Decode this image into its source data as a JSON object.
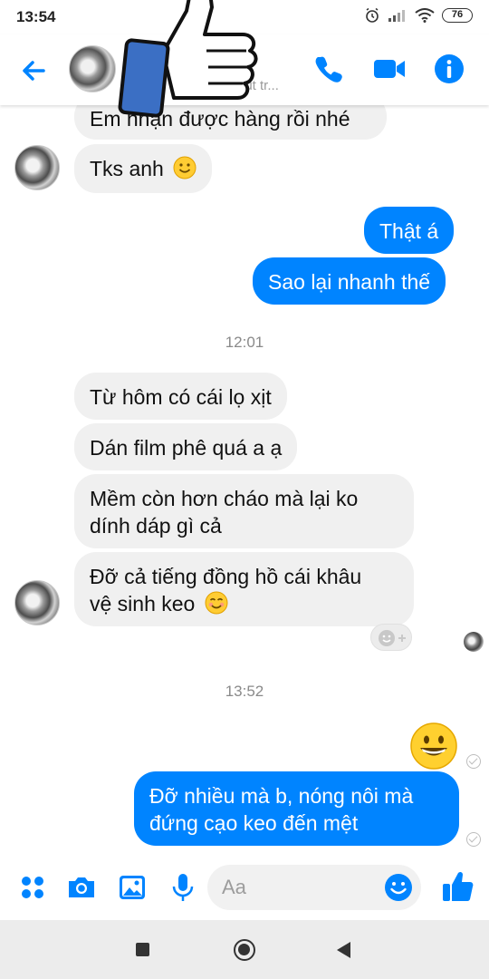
{
  "status_bar": {
    "time": "13:54",
    "battery": "76"
  },
  "header": {
    "subtitle": "nút tr..."
  },
  "messages": {
    "m1": "Em nhận được hàng rồi nhé",
    "m2": "Tks anh",
    "m3": "Thật á",
    "m4": "Sao lại nhanh thế",
    "t1": "12:01",
    "m5": "Từ hôm có cái lọ xịt",
    "m6": "Dán film phê quá a ạ",
    "m7_line1": "Mềm còn hơn cháo mà lại ko",
    "m7_line2": "dính dáp gì cả",
    "m8_line1": "Đỡ cả tiếng đồng hồ cái khâu",
    "m8_line2": "vệ sinh keo",
    "t2": "13:52",
    "m9_line1": "Đỡ nhiều mà b, nóng nôi mà",
    "m9_line2": "đứng cạo keo đến mệt"
  },
  "composer": {
    "placeholder": "Aa"
  },
  "colors": {
    "accent": "#0084ff",
    "incoming_bubble": "#f0f0f0",
    "thumb_fill": "#3b6fc4"
  },
  "icons": [
    "back-arrow-icon",
    "phone-icon",
    "video-camera-icon",
    "info-icon",
    "apps-icon",
    "camera-icon",
    "image-icon",
    "microphone-icon",
    "emoji-icon",
    "like-icon"
  ]
}
